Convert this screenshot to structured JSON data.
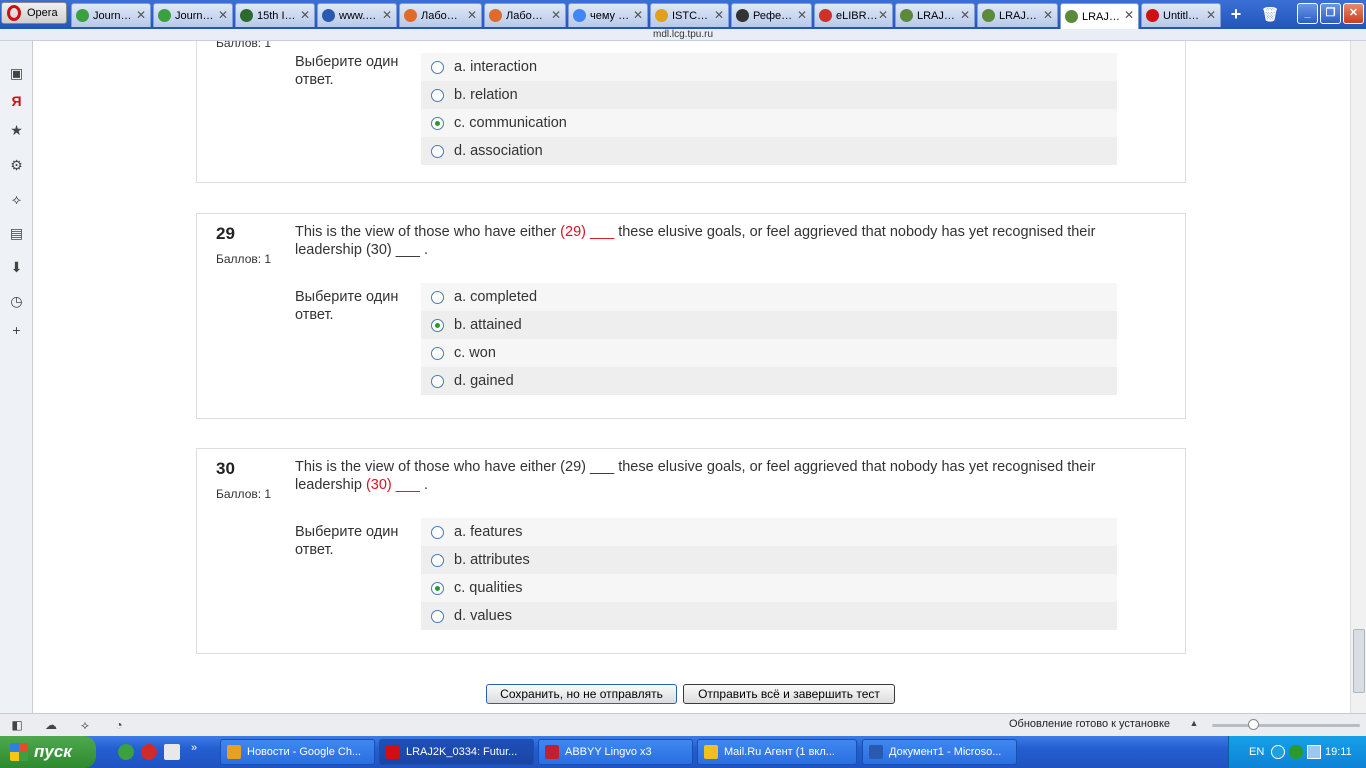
{
  "browser": {
    "menu_label": "Opera",
    "address": "mdl.lcg.tpu.ru",
    "tabs": [
      {
        "label": "Journ…",
        "icon": "green-circle-icon",
        "color": "#3aa040"
      },
      {
        "label": "Journ…",
        "icon": "green-circle-icon",
        "color": "#3aa040"
      },
      {
        "label": "15th I…",
        "icon": "leaf-icon",
        "color": "#2d6a2d"
      },
      {
        "label": "www.…",
        "icon": "site-icon",
        "color": "#2a5ab0"
      },
      {
        "label": "Лабо…",
        "icon": "orange-circle-icon",
        "color": "#e06a2a"
      },
      {
        "label": "Лабо…",
        "icon": "orange-circle-icon",
        "color": "#e06a2a"
      },
      {
        "label": "чему …",
        "icon": "google-icon",
        "color": "#4285f4"
      },
      {
        "label": "ISTC…",
        "icon": "istc-icon",
        "color": "#e0a020"
      },
      {
        "label": "Рефе…",
        "icon": "graduation-cap-icon",
        "color": "#333333"
      },
      {
        "label": "eLIBR…",
        "icon": "elibrary-icon",
        "color": "#d0302a"
      },
      {
        "label": "LRAJ…",
        "icon": "moodle-icon",
        "color": "#5a8a3a"
      },
      {
        "label": "LRAJ…",
        "icon": "moodle-icon",
        "color": "#5a8a3a"
      },
      {
        "label": "LRAJ…",
        "icon": "moodle-icon",
        "color": "#5a8a3a"
      },
      {
        "label": "Untitl…",
        "icon": "opera-icon",
        "color": "#d01010"
      }
    ]
  },
  "questions": [
    {
      "number": "",
      "grade": "Баллов: 1",
      "prompt": "Выберите один ответ.",
      "answers": [
        {
          "label": "a. interaction",
          "selected": false
        },
        {
          "label": "b. relation",
          "selected": false
        },
        {
          "label": "c. communication",
          "selected": true
        },
        {
          "label": "d. association",
          "selected": false
        }
      ]
    },
    {
      "number": "29",
      "grade": "Баллов: 1",
      "text_before": "This is the view of those who have either ",
      "blank1": "(29) ___",
      "text_middle": "  these elusive goals, or feel aggrieved that nobody has yet recognised their leadership ",
      "blank2": "(30) ___",
      "text_after": " .",
      "prompt": "Выберите один ответ.",
      "answers": [
        {
          "label": "a. completed",
          "selected": false
        },
        {
          "label": "b. attained",
          "selected": true
        },
        {
          "label": "c. won",
          "selected": false
        },
        {
          "label": "d. gained",
          "selected": false
        }
      ]
    },
    {
      "number": "30",
      "grade": "Баллов: 1",
      "text_before": "This is the view of those who have either ",
      "blank1": "(29) ___",
      "text_middle": "  these elusive goals, or feel aggrieved that nobody has yet recognised their leadership  ",
      "blank2": "(30) ___",
      "text_after": " .",
      "prompt": "Выберите один ответ.",
      "answers": [
        {
          "label": "a. features",
          "selected": false
        },
        {
          "label": "b. attributes",
          "selected": false
        },
        {
          "label": "c. qualities",
          "selected": true
        },
        {
          "label": "d. values",
          "selected": false
        }
      ]
    }
  ],
  "buttons": {
    "save_label": "Сохранить, но не отправлять",
    "submit_label": "Отправить всё и завершить тест"
  },
  "statusbar": {
    "update_text": "Обновление готово к установке"
  },
  "taskbar": {
    "start_label": "пуск",
    "tasks": [
      {
        "label": "Новости - Google Ch...",
        "icon": "chrome-icon",
        "color": "#e8a020"
      },
      {
        "label": "LRAJ2K_0334: Futur...",
        "icon": "opera-icon",
        "color": "#d01010"
      },
      {
        "label": "ABBYY Lingvo x3",
        "icon": "lingvo-icon",
        "color": "#c02030"
      },
      {
        "label": "Mail.Ru Агент (1 вкл...",
        "icon": "mail-icon",
        "color": "#f0c020"
      },
      {
        "label": "Документ1 - Microso...",
        "icon": "word-icon",
        "color": "#2a5ab0"
      }
    ],
    "tray_language": "EN",
    "clock": "19:11"
  }
}
